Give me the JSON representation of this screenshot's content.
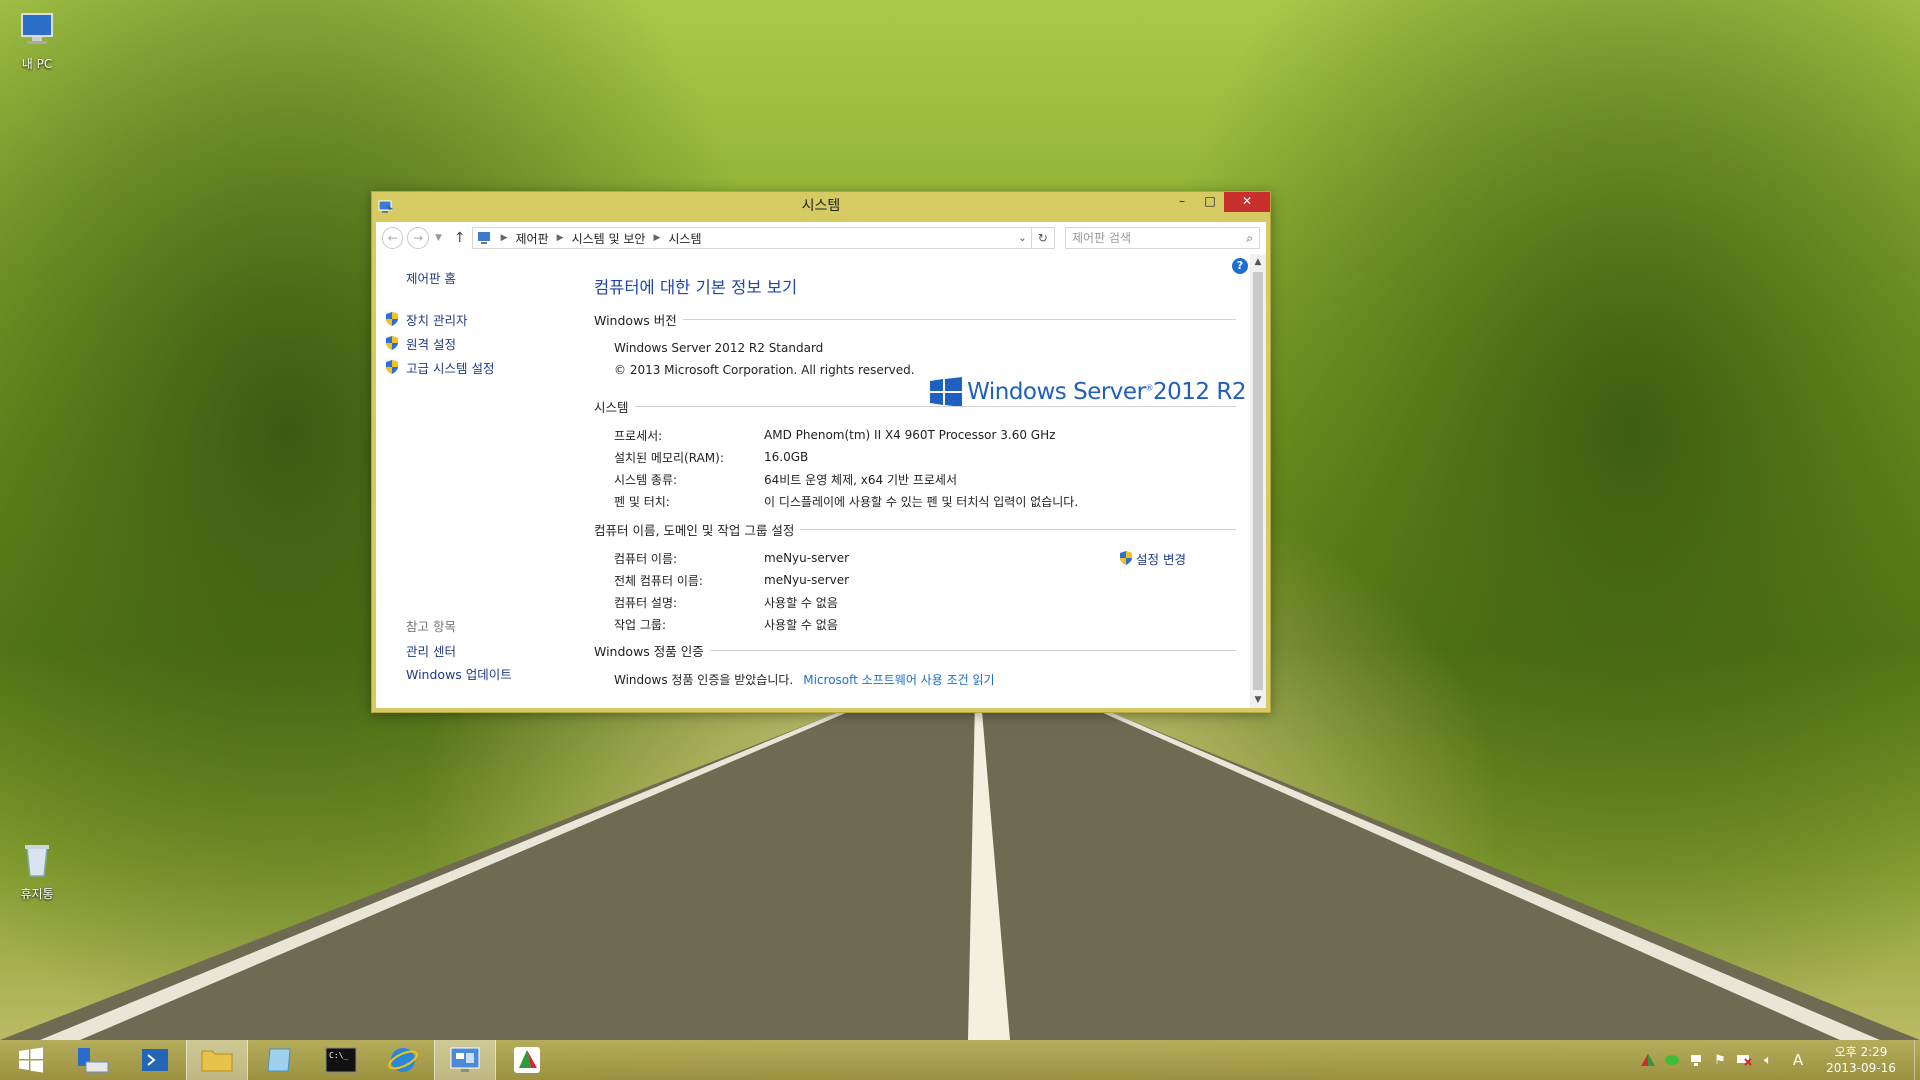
{
  "desktop": {
    "icons": [
      {
        "label": "내 PC"
      },
      {
        "label": "휴지통"
      }
    ]
  },
  "window": {
    "title": "시스템",
    "buttons": {
      "minimize": "–",
      "maximize": "□",
      "close": "✕"
    },
    "breadcrumb": [
      "제어판",
      "시스템 및 보안",
      "시스템"
    ],
    "search_placeholder": "제어판 검색",
    "left": {
      "home": "제어판 홈",
      "links": [
        "장치 관리자",
        "원격 설정",
        "고급 시스템 설정"
      ],
      "see_also_header": "참고 항목",
      "see_also": [
        "관리 센터",
        "Windows 업데이트"
      ]
    },
    "main": {
      "title": "컴퓨터에 대한 기본 정보 보기",
      "edition": {
        "header": "Windows 버전",
        "name": "Windows Server 2012 R2 Standard",
        "copyright": "© 2013 Microsoft Corporation. All rights reserved.",
        "logo_text": "Windows Server",
        "logo_version": "2012 R2"
      },
      "system": {
        "header": "시스템",
        "rows": [
          {
            "k": "프로세서:",
            "v": "AMD Phenom(tm) II X4 960T Processor   3.60 GHz"
          },
          {
            "k": "설치된 메모리(RAM):",
            "v": "16.0GB"
          },
          {
            "k": "시스템 종류:",
            "v": "64비트 운영 체제, x64 기반 프로세서"
          },
          {
            "k": "펜 및 터치:",
            "v": "이 디스플레이에 사용할 수 있는 펜 및 터치식 입력이 없습니다."
          }
        ]
      },
      "computer": {
        "header": "컴퓨터 이름, 도메인 및 작업 그룹 설정",
        "change_link": "설정 변경",
        "rows": [
          {
            "k": "컴퓨터 이름:",
            "v": "meNyu-server"
          },
          {
            "k": "전체 컴퓨터 이름:",
            "v": "meNyu-server"
          },
          {
            "k": "컴퓨터 설명:",
            "v": "사용할 수 없음"
          },
          {
            "k": "작업 그룹:",
            "v": "사용할 수 없음"
          }
        ]
      },
      "activation": {
        "header": "Windows 정품 인증",
        "status": "Windows 정품 인증을 받았습니다.",
        "license_link": "Microsoft 소프트웨어 사용 조건 읽기"
      }
    }
  },
  "taskbar": {
    "clock_time": "오후 2:29",
    "clock_date": "2013-09-16",
    "ime": "A"
  },
  "colors": {
    "window_frame": "#d6ca62",
    "link": "#1e3a8a",
    "title_blue": "#1d47a8",
    "close_red": "#c7302c"
  }
}
